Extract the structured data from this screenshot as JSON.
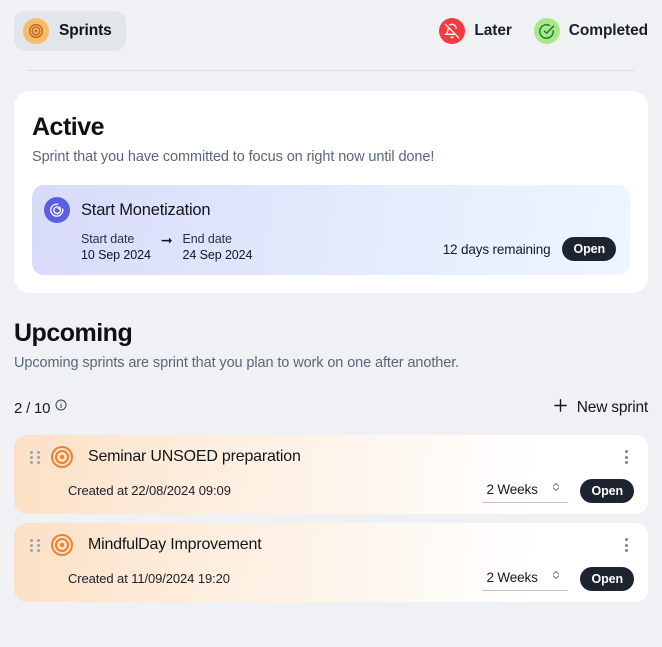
{
  "header": {
    "tab": {
      "label": "Sprints",
      "icon": "target-icon"
    },
    "actions": [
      {
        "label": "Later",
        "icon": "bell-off-icon",
        "color": "#f33b40"
      },
      {
        "label": "Completed",
        "icon": "check-circle-icon",
        "color": "#a7e888"
      }
    ]
  },
  "active": {
    "title": "Active",
    "subtitle": "Sprint that you have committed to focus on right now until done!",
    "sprint": {
      "name": "Start Monetization",
      "icon": "sprint-play-icon",
      "start_label": "Start date",
      "start_value": "10 Sep 2024",
      "end_label": "End date",
      "end_value": "24 Sep 2024",
      "days_remaining": "12 days remaining",
      "status": "Open"
    }
  },
  "upcoming": {
    "title": "Upcoming",
    "subtitle": "Upcoming sprints are sprint that you plan to work on one after another.",
    "count": "2 / 10",
    "info_icon": "info-icon",
    "new_sprint_label": "New sprint",
    "plus_icon": "plus-icon",
    "sprints": [
      {
        "name": "Seminar UNSOED preparation",
        "icon": "target-icon",
        "created_at": "Created at 22/08/2024 09:09",
        "duration": "2 Weeks",
        "status": "Open"
      },
      {
        "name": "MindfulDay Improvement",
        "icon": "target-icon",
        "created_at": "Created at 11/09/2024 19:20",
        "duration": "2 Weeks",
        "status": "Open"
      }
    ]
  },
  "colors": {
    "page_bg": "#eff1f4",
    "accent_orange": "#f07f2d",
    "accent_purple": "#5d5fe3",
    "badge_dark": "#1d2430"
  }
}
